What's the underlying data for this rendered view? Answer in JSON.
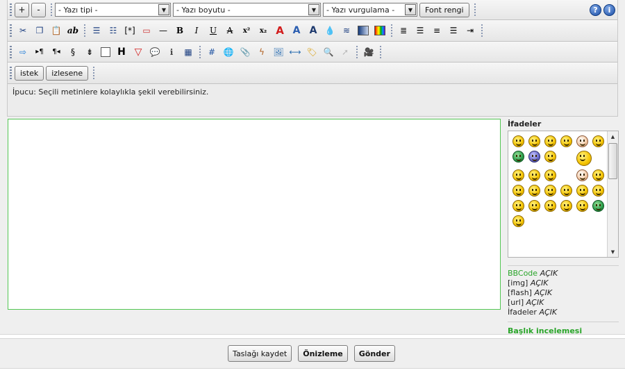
{
  "toolbar": {
    "increase_label": "+",
    "decrease_label": "-",
    "font_family_select": "- Yazı tipi -",
    "font_size_select": "- Yazı boyutu -",
    "highlight_select": "- Yazı vurgulama -",
    "font_color_button": "Font rengi",
    "help_icon_glyph": "?",
    "info_icon_glyph": "i",
    "formatting_icons": [
      "cut-icon",
      "copy-icon",
      "paste-icon",
      "spellcheck-icon",
      "unordered-list-icon",
      "ordered-list-icon",
      "list-item-icon",
      "frame-icon",
      "horizontal-rule-icon",
      "bold-icon",
      "italic-icon",
      "underline-icon",
      "strikethrough-icon",
      "superscript-icon",
      "subscript-icon",
      "text-shadow-icon",
      "text-glow-icon",
      "text-outline-icon",
      "drop-shadow-icon",
      "wave-icon",
      "gradient-icon",
      "color-swatch-icon",
      "align-justify-icon",
      "align-left-icon",
      "align-center-icon",
      "align-right-icon",
      "indent-icon"
    ],
    "insert_icons": [
      "marquee-icon",
      "paragraph-ltr-icon",
      "paragraph-rtl-icon",
      "special-chars-icon",
      "text-direction-icon",
      "blank-box-icon",
      "heading-icon",
      "warning-icon",
      "speech-icon",
      "info-box-icon",
      "table-icon",
      "hash-icon",
      "web-link-icon",
      "attachment-icon",
      "flash-icon",
      "image-icon",
      "media-icon",
      "tag-icon",
      "search-icon",
      "cursor-icon",
      "video-icon"
    ],
    "custom_tags": [
      "istek",
      "izlesene"
    ]
  },
  "hint": "İpucu: Seçili metinlere kolaylıkla şekil verebilirsiniz.",
  "editor": {
    "content": ""
  },
  "smilies": {
    "title": "İfadeler",
    "icons": [
      "smiley-grin",
      "smiley-happy",
      "smiley-smile",
      "smiley-laugh",
      "smiley-eyes",
      "smiley-glasses",
      "smiley-green",
      "smiley-blue",
      "smiley-cool",
      "smiley-big",
      "smiley-wink",
      "smiley-blush",
      "smiley-cheer",
      "smiley-pale",
      "smiley-dizzy",
      "smiley-sad",
      "smiley-sleepy",
      "smiley-tongue",
      "smiley-devil",
      "smiley-angry",
      "smiley-nerd",
      "smiley-exclaim",
      "smiley-question",
      "smiley-idea",
      "smiley-plain",
      "smiley-neutral",
      "smiley-green-grin",
      "smiley-glasses-2"
    ]
  },
  "status": [
    {
      "label": "BBCode",
      "value": "AÇIK"
    },
    {
      "label": "[img]",
      "value": "AÇIK"
    },
    {
      "label": "[flash]",
      "value": "AÇIK"
    },
    {
      "label": "[url]",
      "value": "AÇIK"
    },
    {
      "label": "İfadeler",
      "value": "AÇIK"
    }
  ],
  "review_link": "Başlık incelemesi",
  "actions": {
    "save_draft": "Taslağı kaydet",
    "preview": "Önizleme",
    "submit": "Gönder"
  },
  "colors": {
    "accent_green": "#2aa52a",
    "editor_border": "#53c653"
  }
}
